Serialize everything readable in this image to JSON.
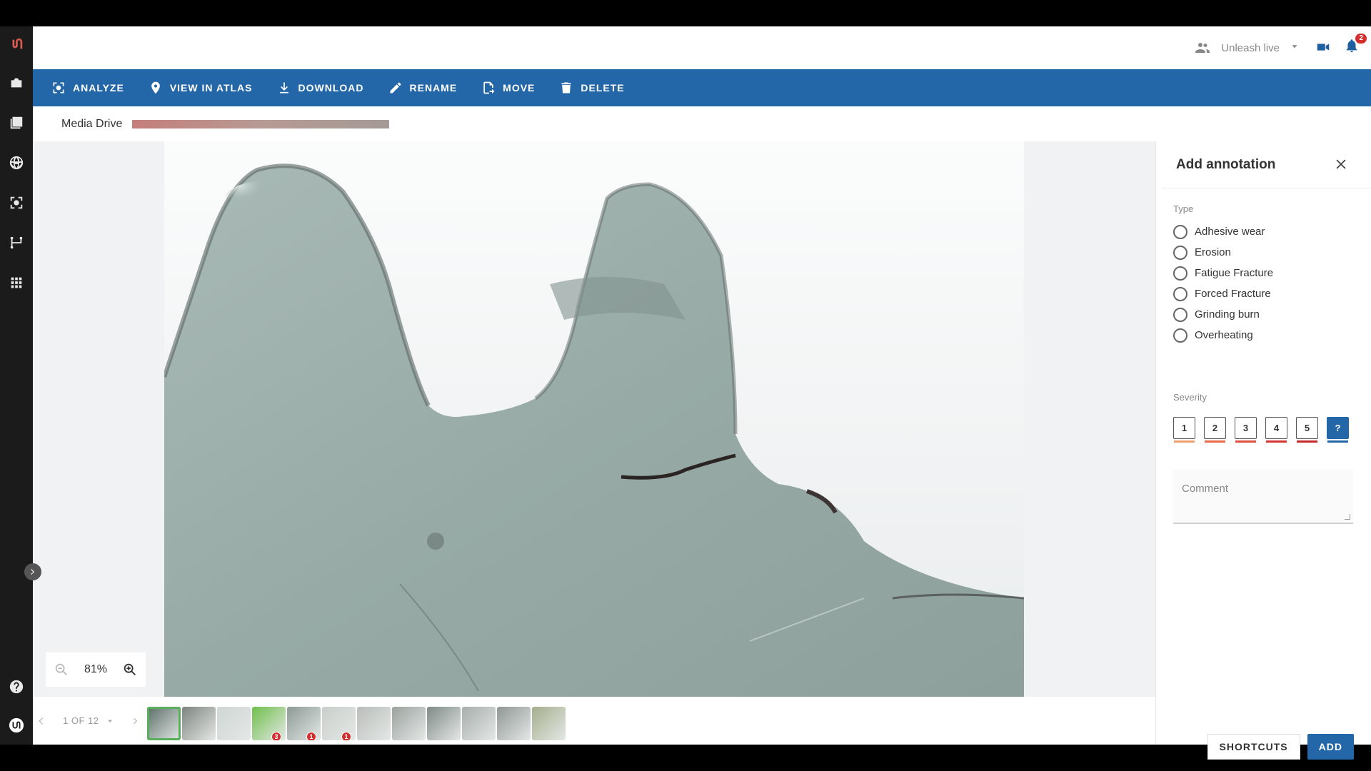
{
  "header": {
    "user": "Unleash live",
    "notification_count": "2"
  },
  "toolbar": {
    "analyze": "ANALYZE",
    "view_atlas": "VIEW IN ATLAS",
    "download": "DOWNLOAD",
    "rename": "RENAME",
    "move": "MOVE",
    "delete": "DELETE"
  },
  "breadcrumb": {
    "root": "Media Drive"
  },
  "viewer": {
    "zoom": "81%"
  },
  "pager": {
    "label": "1 OF 12"
  },
  "thumbnails": [
    {
      "badge": ""
    },
    {
      "badge": ""
    },
    {
      "badge": ""
    },
    {
      "badge": "3"
    },
    {
      "badge": "1"
    },
    {
      "badge": "1"
    },
    {
      "badge": ""
    },
    {
      "badge": ""
    },
    {
      "badge": ""
    },
    {
      "badge": ""
    },
    {
      "badge": ""
    },
    {
      "badge": ""
    }
  ],
  "panel": {
    "title": "Add annotation",
    "type_label": "Type",
    "types": [
      "Adhesive wear",
      "Erosion",
      "Fatigue Fracture",
      "Forced Fracture",
      "Grinding burn",
      "Overheating"
    ],
    "severity_label": "Severity",
    "severity": [
      "1",
      "2",
      "3",
      "4",
      "5",
      "?"
    ],
    "severity_colors": [
      "#f0a070",
      "#e86a4a",
      "#e05040",
      "#d83535",
      "#c52a2a",
      "#2467a8"
    ],
    "comment_placeholder": "Comment",
    "shortcuts": "SHORTCUTS",
    "add": "ADD"
  },
  "colors": {
    "toolbar": "#2467a8",
    "rail": "#1b1b1b"
  }
}
